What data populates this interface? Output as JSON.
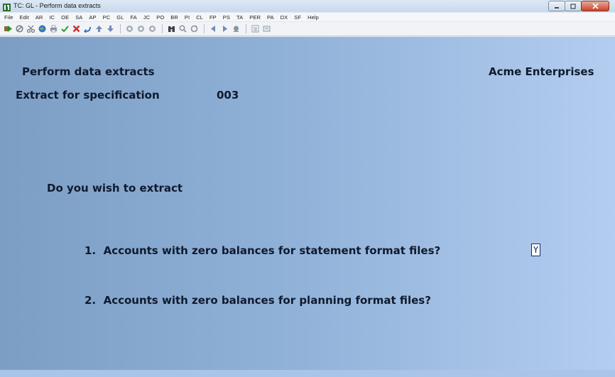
{
  "window": {
    "title": "TC: GL - Perform data extracts"
  },
  "menu": {
    "items": [
      "File",
      "Edit",
      "AR",
      "IC",
      "OE",
      "SA",
      "AP",
      "PC",
      "GL",
      "FA",
      "JC",
      "PO",
      "BR",
      "PI",
      "CL",
      "FP",
      "PS",
      "TA",
      "PER",
      "PA",
      "DX",
      "SF",
      "Help"
    ]
  },
  "toolbar": {
    "icons": [
      "run-icon",
      "cancel-icon",
      "scissors-icon",
      "globe-icon",
      "print-icon",
      "check-icon",
      "delete-icon",
      "undo-icon",
      "up-arrow-icon",
      "down-arrow-icon",
      "circle-1-icon",
      "circle-2-icon",
      "circle-3-icon",
      "binoculars-icon",
      "zoom-icon",
      "refresh-icon",
      "back-icon",
      "forward-icon",
      "record-icon",
      "list-icon",
      "settings-icon"
    ]
  },
  "screen": {
    "title": "Perform data extracts",
    "company": "Acme Enterprises",
    "spec_label": "Extract for specification",
    "spec_value": "003",
    "prompt": "Do you wish to extract",
    "question1": "1.  Accounts with zero balances for statement format files?",
    "question2": "2.  Accounts with zero balances for planning format files?",
    "answer1": "Y"
  },
  "colors": {
    "content_left": "#7d9ec4",
    "content_right": "#b3cdf0",
    "text": "#0f1a2e",
    "close_button": "#c7462b"
  }
}
